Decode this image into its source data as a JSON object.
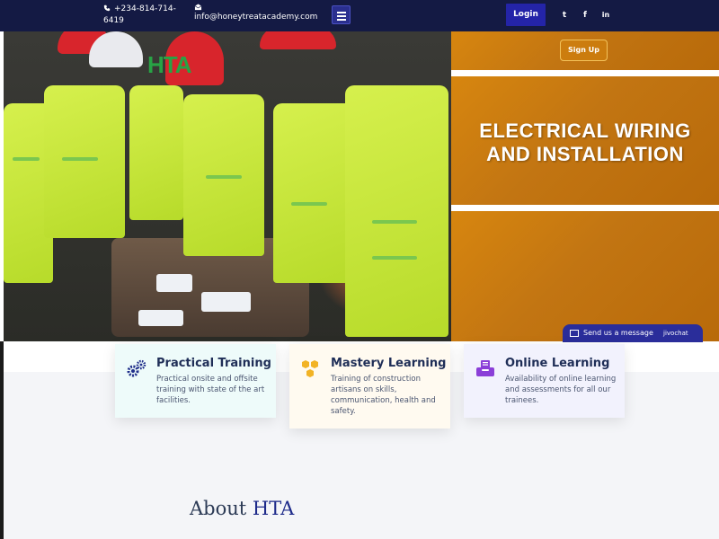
{
  "topbar": {
    "phone": "+234-814-714-6419",
    "email": "info@honeytreatacademy.com",
    "login_label": "Login",
    "social": [
      {
        "icon": "twitter-icon",
        "glyph": "t"
      },
      {
        "icon": "facebook-icon",
        "glyph": "f"
      },
      {
        "icon": "linkedin-icon",
        "glyph": "in"
      }
    ]
  },
  "hero": {
    "logo_text": "HTA",
    "signup_label": "Sign Up",
    "banner_line1": "ELECTRICAL WIRING",
    "banner_line2": "AND INSTALLATION"
  },
  "chat": {
    "label": "Send us a message",
    "brand": "jivochat"
  },
  "features": [
    {
      "title": "Practical Training",
      "description": "Practical onsite and offsite training with state of the art facilities.",
      "icon": "gears-icon"
    },
    {
      "title": "Mastery Learning",
      "description": "Training of construction artisans on skills, communication, health and safety.",
      "icon": "honeycomb-icon"
    },
    {
      "title": "Online Learning",
      "description": "Availability of online learning and assessments for all our trainees.",
      "icon": "online-tray-icon"
    }
  ],
  "about": {
    "prefix": "About ",
    "accent": "HTA"
  },
  "colors": {
    "topbar_bg": "#141a44",
    "login_bg": "#2424a8",
    "banner_orange": "#c27512",
    "heading_blue": "#1f2e57"
  }
}
